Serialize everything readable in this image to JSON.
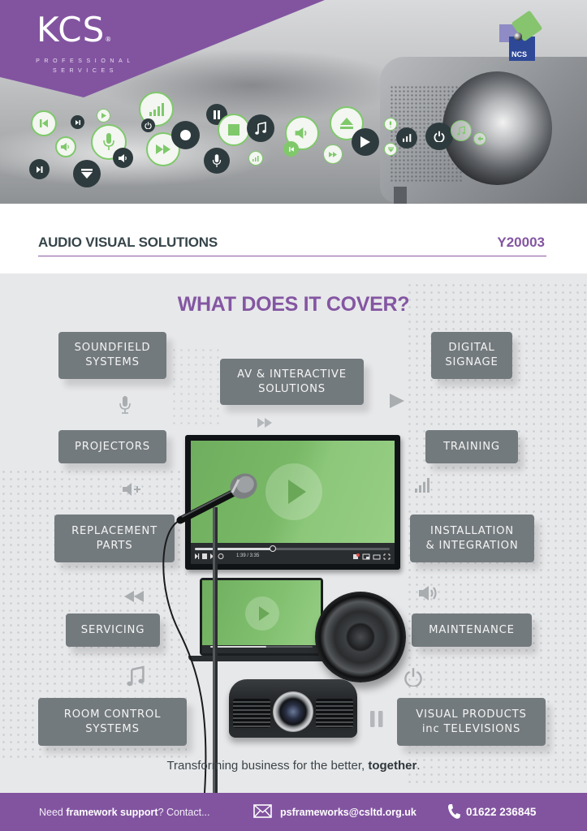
{
  "header": {
    "brand": "KCS",
    "brand_mark": "®",
    "brand_tagline_line1": "PROFESSIONAL",
    "brand_tagline_line2": "SERVICES",
    "partner_logo_text": "NCS",
    "hero_icons": [
      "previous-icon",
      "skip-icon",
      "play-icon",
      "volume-icon",
      "microphone-icon",
      "signal-icon",
      "power-icon",
      "fast-forward-icon",
      "record-icon",
      "pause-icon",
      "stop-icon",
      "music-note-icon",
      "eject-icon",
      "power-icon",
      "volume-down-icon"
    ]
  },
  "title_row": {
    "title": "AUDIO VISUAL SOLUTIONS",
    "code": "Y20003"
  },
  "cover": {
    "heading": "WHAT DOES IT COVER?",
    "services": [
      {
        "line1": "SOUNDFIELD",
        "line2": "SYSTEMS"
      },
      {
        "line1": "AV & INTERACTIVE",
        "line2": "SOLUTIONS"
      },
      {
        "line1": "DIGITAL",
        "line2": "SIGNAGE"
      },
      {
        "line1": "PROJECTORS",
        "line2": ""
      },
      {
        "line1": "TRAINING",
        "line2": ""
      },
      {
        "line1": "REPLACEMENT",
        "line2": "PARTS"
      },
      {
        "line1": "INSTALLATION",
        "line2": "& INTEGRATION"
      },
      {
        "line1": "SERVICING",
        "line2": ""
      },
      {
        "line1": "MAINTENANCE",
        "line2": ""
      },
      {
        "line1": "ROOM CONTROL",
        "line2": "SYSTEMS"
      },
      {
        "line1": "VISUAL PRODUCTS",
        "line2": "inc TELEVISIONS"
      }
    ],
    "video_player": {
      "time": "1:39 / 3:35",
      "progress": 0.4
    },
    "laptop_player": {
      "progress": 0.55
    },
    "tagline_prefix": "Transforming business for the better, ",
    "tagline_bold": "together",
    "tagline_suffix": "."
  },
  "footer": {
    "need": "Need ",
    "need_bold": "framework support",
    "need_suffix": "? Contact...",
    "email": "psframeworks@csltd.org.uk",
    "phone": "01622 236845"
  },
  "colors": {
    "brand_purple": "#8254a0",
    "accent_green": "#7fc96b",
    "box_grey": "#737a7d",
    "text_dark": "#36454a"
  }
}
